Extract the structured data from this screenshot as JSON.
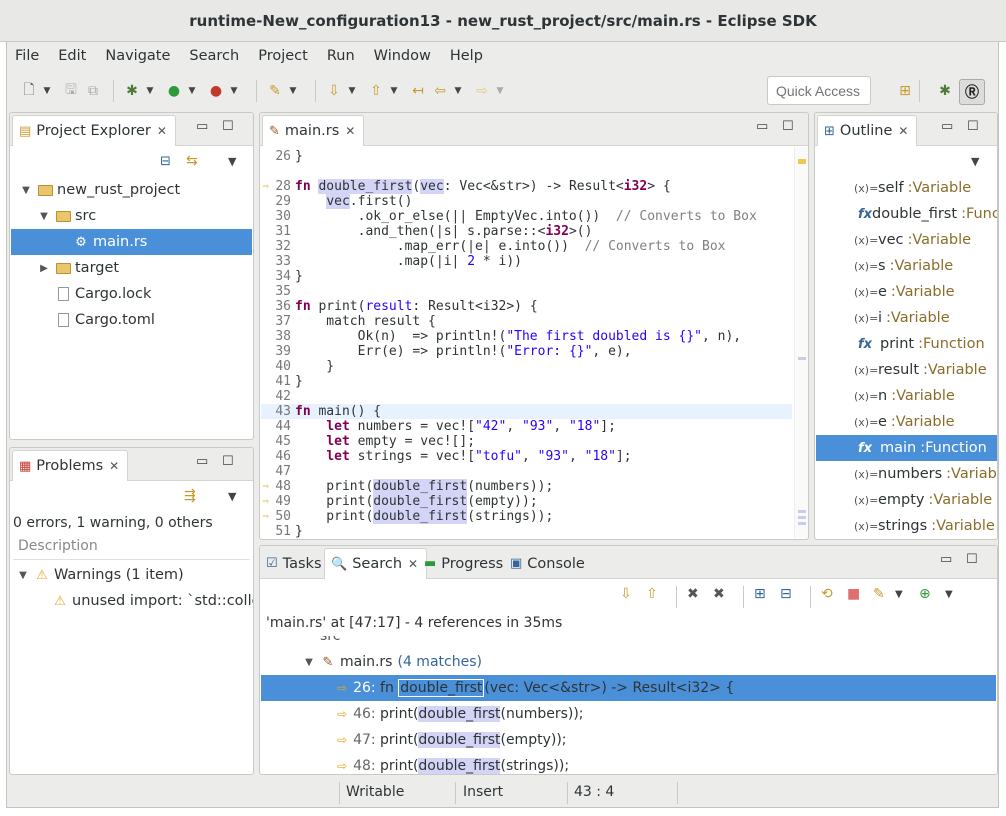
{
  "window_title": "runtime-New_configuration13 - new_rust_project/src/main.rs - Eclipse SDK",
  "menu": [
    "File",
    "Edit",
    "Navigate",
    "Search",
    "Project",
    "Run",
    "Window",
    "Help"
  ],
  "quick_access": {
    "placeholder": "Quick Access"
  },
  "project_explorer": {
    "title": "Project Explorer",
    "items": [
      {
        "label": "new_rust_project",
        "depth": 0,
        "twisty": "open",
        "icon": "project-icon"
      },
      {
        "label": "src",
        "depth": 1,
        "twisty": "open",
        "icon": "folder-icon"
      },
      {
        "label": "main.rs",
        "depth": 2,
        "twisty": "",
        "icon": "rust-file-icon",
        "selected": true
      },
      {
        "label": "target",
        "depth": 1,
        "twisty": "closed",
        "icon": "folder-icon"
      },
      {
        "label": "Cargo.lock",
        "depth": 1,
        "twisty": "",
        "icon": "file-icon"
      },
      {
        "label": "Cargo.toml",
        "depth": 1,
        "twisty": "",
        "icon": "file-icon"
      }
    ]
  },
  "problems": {
    "title": "Problems",
    "summary": "0 errors, 1 warning, 0 others",
    "column": "Description",
    "group": "Warnings (1 item)",
    "item": "unused import: `std::collectic"
  },
  "editor": {
    "tab": "main.rs",
    "lines": [
      {
        "n": "26",
        "segs": [
          [
            "}",
            ""
          ]
        ]
      },
      {
        "n": "",
        "segs": []
      },
      {
        "n": "28",
        "mark": true,
        "segs": [
          [
            "fn ",
            "kw"
          ],
          [
            "double_first",
            "hl"
          ],
          [
            "(",
            ""
          ],
          [
            "vec",
            "hl"
          ],
          [
            ": Vec<&str>) -> Result<",
            ""
          ],
          [
            "i32",
            "kw"
          ],
          [
            "> {",
            ""
          ]
        ]
      },
      {
        "n": "29",
        "segs": [
          [
            "    ",
            ""
          ],
          [
            "vec",
            "hl"
          ],
          [
            ".first()",
            ""
          ]
        ]
      },
      {
        "n": "30",
        "segs": [
          [
            "        .ok_or_else(|| EmptyVec.into())  ",
            ""
          ],
          [
            "// Converts to Box",
            "cm"
          ]
        ]
      },
      {
        "n": "31",
        "segs": [
          [
            "        .and_then(|s| s.parse::<",
            ""
          ],
          [
            "i32",
            "kw"
          ],
          [
            ">()",
            ""
          ]
        ]
      },
      {
        "n": "32",
        "segs": [
          [
            "             .map_err(|e| e.into())  ",
            ""
          ],
          [
            "// Converts to Box",
            "cm"
          ]
        ]
      },
      {
        "n": "33",
        "segs": [
          [
            "             .map(|i| ",
            ""
          ],
          [
            "2",
            "st"
          ],
          [
            " * i))",
            ""
          ]
        ]
      },
      {
        "n": "34",
        "segs": [
          [
            "}",
            ""
          ]
        ]
      },
      {
        "n": "35",
        "segs": []
      },
      {
        "n": "36",
        "segs": [
          [
            "fn ",
            "kw"
          ],
          [
            "print(",
            ""
          ],
          [
            "result",
            "st"
          ],
          [
            ": Result<i32>) {",
            ""
          ]
        ]
      },
      {
        "n": "37",
        "segs": [
          [
            "    match result {",
            ""
          ]
        ]
      },
      {
        "n": "38",
        "segs": [
          [
            "        Ok(n)  => println!(",
            ""
          ],
          [
            "\"The first doubled is {}\"",
            "st"
          ],
          [
            ", n),",
            ""
          ]
        ]
      },
      {
        "n": "39",
        "segs": [
          [
            "        Err(e) => println!(",
            ""
          ],
          [
            "\"Error: {}\"",
            "st"
          ],
          [
            ", e),",
            ""
          ]
        ]
      },
      {
        "n": "40",
        "segs": [
          [
            "    }",
            ""
          ]
        ]
      },
      {
        "n": "41",
        "segs": [
          [
            "}",
            ""
          ]
        ]
      },
      {
        "n": "42",
        "segs": []
      },
      {
        "n": "43",
        "current": true,
        "segs": [
          [
            "fn ",
            "kw"
          ],
          [
            "main() {",
            ""
          ]
        ]
      },
      {
        "n": "44",
        "segs": [
          [
            "    ",
            ""
          ],
          [
            "let",
            "kw"
          ],
          [
            " numbers = vec![",
            ""
          ],
          [
            "\"42\"",
            "st"
          ],
          [
            ", ",
            ""
          ],
          [
            "\"93\"",
            "st"
          ],
          [
            ", ",
            ""
          ],
          [
            "\"18\"",
            "st"
          ],
          [
            "];",
            ""
          ]
        ]
      },
      {
        "n": "45",
        "segs": [
          [
            "    ",
            ""
          ],
          [
            "let",
            "kw"
          ],
          [
            " empty = vec![];",
            ""
          ]
        ]
      },
      {
        "n": "46",
        "segs": [
          [
            "    ",
            ""
          ],
          [
            "let",
            "kw"
          ],
          [
            " strings = vec![",
            ""
          ],
          [
            "\"tofu\"",
            "st"
          ],
          [
            ", ",
            ""
          ],
          [
            "\"93\"",
            "st"
          ],
          [
            ", ",
            ""
          ],
          [
            "\"18\"",
            "st"
          ],
          [
            "];",
            ""
          ]
        ]
      },
      {
        "n": "47",
        "segs": []
      },
      {
        "n": "48",
        "mark": true,
        "segs": [
          [
            "    print(",
            ""
          ],
          [
            "double_first",
            "hl"
          ],
          [
            "(numbers));",
            ""
          ]
        ]
      },
      {
        "n": "49",
        "mark": true,
        "segs": [
          [
            "    print(",
            ""
          ],
          [
            "double_first",
            "hl"
          ],
          [
            "(empty));",
            ""
          ]
        ]
      },
      {
        "n": "50",
        "mark": true,
        "segs": [
          [
            "    print(",
            ""
          ],
          [
            "double_first",
            "hl"
          ],
          [
            "(strings));",
            ""
          ]
        ]
      },
      {
        "n": "51",
        "segs": [
          [
            "}",
            ""
          ]
        ]
      }
    ]
  },
  "outline": {
    "title": "Outline",
    "items": [
      {
        "kind": "var",
        "name": "self",
        "type": ":Variable"
      },
      {
        "kind": "fn",
        "name": "double_first",
        "type": ":Func"
      },
      {
        "kind": "var",
        "name": "vec",
        "type": ":Variable"
      },
      {
        "kind": "var",
        "name": "s",
        "type": ":Variable"
      },
      {
        "kind": "var",
        "name": "e",
        "type": ":Variable"
      },
      {
        "kind": "var",
        "name": "i",
        "type": ":Variable"
      },
      {
        "kind": "fn",
        "name": "print",
        "type": ":Function"
      },
      {
        "kind": "var",
        "name": "result",
        "type": ":Variable"
      },
      {
        "kind": "var",
        "name": "n",
        "type": ":Variable"
      },
      {
        "kind": "var",
        "name": "e",
        "type": ":Variable"
      },
      {
        "kind": "fn",
        "name": "main",
        "type": ":Function",
        "selected": true
      },
      {
        "kind": "var",
        "name": "numbers",
        "type": ":Variable"
      },
      {
        "kind": "var",
        "name": "empty",
        "type": ":Variable"
      },
      {
        "kind": "var",
        "name": "strings",
        "type": ":Variable"
      }
    ]
  },
  "bottom": {
    "tabs": [
      "Tasks",
      "Search",
      "Progress",
      "Console"
    ],
    "query": "'main.rs' at [47:17] - 4 references in 35ms",
    "partial": "src",
    "file": "main.rs",
    "matches": "(4 matches)",
    "results": [
      {
        "ln": "26:",
        "pre": " fn ",
        "hit": "double_first",
        "post": "(vec: Vec<&str>) -> Result<i32> {",
        "selected": true
      },
      {
        "ln": "46:",
        "pre": " print(",
        "hit": "double_first",
        "post": "(numbers));"
      },
      {
        "ln": "47:",
        "pre": " print(",
        "hit": "double_first",
        "post": "(empty));"
      },
      {
        "ln": "48:",
        "pre": " print(",
        "hit": "double_first",
        "post": "(strings));"
      }
    ]
  },
  "status": {
    "writable": "Writable",
    "mode": "Insert",
    "position": "43 : 4"
  }
}
